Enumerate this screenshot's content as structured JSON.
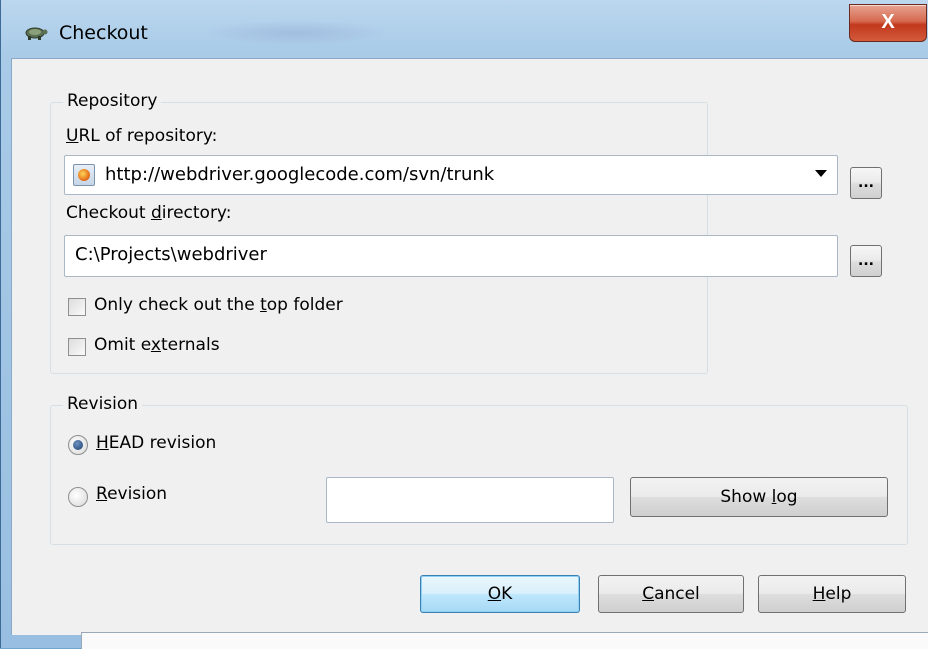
{
  "window": {
    "title": "Checkout",
    "close_label": "X"
  },
  "repository_group": {
    "title": "Repository",
    "url_label_u": "U",
    "url_label_rest": "RL of repository:",
    "url_value": "http://webdriver.googlecode.com/svn/trunk",
    "browse_url_label": "...",
    "dir_label_pre": "Checkout ",
    "dir_label_u": "d",
    "dir_label_post": "irectory:",
    "dir_value": "C:\\Projects\\webdriver",
    "browse_dir_label": "...",
    "top_folder_pre": "Only check out the ",
    "top_folder_u": "t",
    "top_folder_post": "op folder",
    "omit_pre": "Omit e",
    "omit_u": "x",
    "omit_post": "ternals",
    "top_folder_checked": false,
    "omit_checked": false
  },
  "revision_group": {
    "title": "Revision",
    "head_u": "H",
    "head_rest": "EAD revision",
    "rev_u": "R",
    "rev_rest": "evision",
    "revision_value": "",
    "show_log_pre": "Show ",
    "show_log_u": "l",
    "show_log_post": "og",
    "selected": "head"
  },
  "buttons": {
    "ok_u": "O",
    "ok_rest": "K",
    "cancel_u": "C",
    "cancel_rest": "ancel",
    "help_u": "H",
    "help_rest": "elp"
  },
  "colors": {
    "accent": "#3c7fb1",
    "close": "#c2391d"
  }
}
